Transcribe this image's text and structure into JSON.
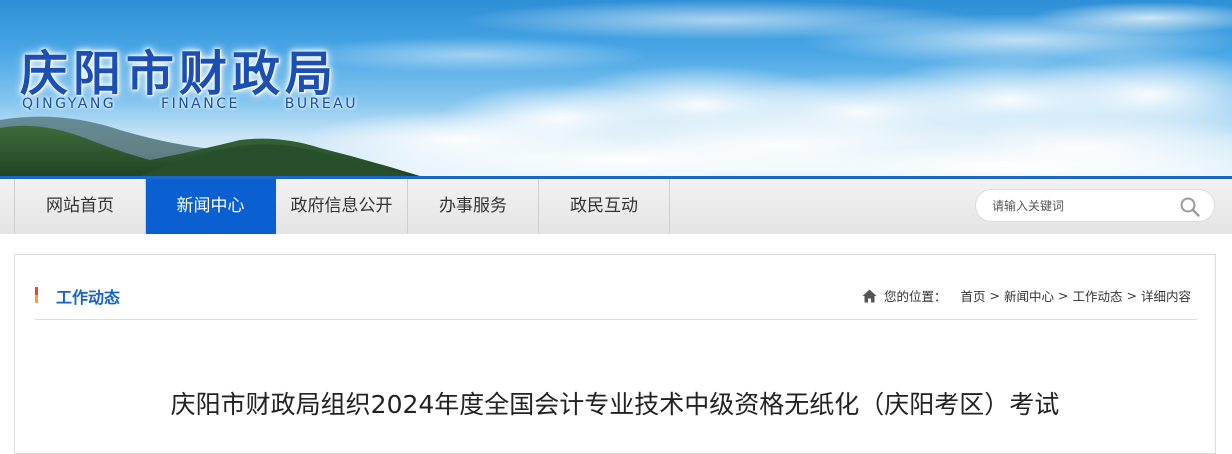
{
  "header": {
    "site_name_cn": "庆阳市财政局",
    "site_name_en": [
      "QINGYANG",
      "FINANCE",
      "BUREAU"
    ]
  },
  "nav": {
    "items": [
      {
        "label": "网站首页",
        "active": false
      },
      {
        "label": "新闻中心",
        "active": true
      },
      {
        "label": "政府信息公开",
        "active": false
      },
      {
        "label": "办事服务",
        "active": false
      },
      {
        "label": "政民互动",
        "active": false
      }
    ],
    "active_color": "#0a5fd1"
  },
  "search": {
    "placeholder": "请输入关键词",
    "icon": "search-icon"
  },
  "section": {
    "title": "工作动态"
  },
  "breadcrumb": {
    "label": "您的位置：",
    "items": [
      "首页",
      "新闻中心",
      "工作动态",
      "详细内容"
    ],
    "separator": ">",
    "icon": "home-icon"
  },
  "article": {
    "title": "庆阳市财政局组织2024年度全国会计专业技术中级资格无纸化（庆阳考区）考试"
  },
  "colors": {
    "brand_blue": "#1b4fb3",
    "nav_active": "#0a5fd1",
    "section_title": "#1563c6"
  }
}
